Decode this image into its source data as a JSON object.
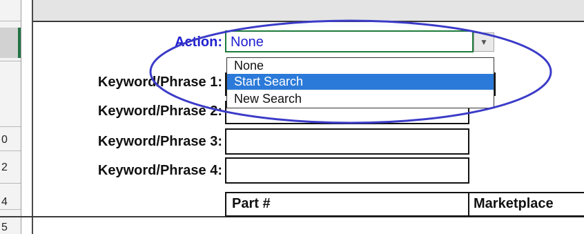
{
  "row_headers": [
    "0",
    "2",
    "4",
    "5"
  ],
  "action": {
    "label": "Action:",
    "value": "None",
    "options": [
      "None",
      "Start Search",
      "New Search"
    ],
    "highlighted_option": "Start Search"
  },
  "keywords": [
    {
      "label": "Keyword/Phrase 1:",
      "value": ""
    },
    {
      "label": "Keyword/Phrase 2:",
      "value": ""
    },
    {
      "label": "Keyword/Phrase 3:",
      "value": ""
    },
    {
      "label": "Keyword/Phrase 4:",
      "value": ""
    }
  ],
  "table_headers": [
    "Part #",
    "Marketplace"
  ],
  "colors": {
    "action_text": "#1f1fd0",
    "selection": "#2b7ad9",
    "annotation_ellipse": "#3b3bc8",
    "active_cell_border": "#1e7a3c"
  }
}
